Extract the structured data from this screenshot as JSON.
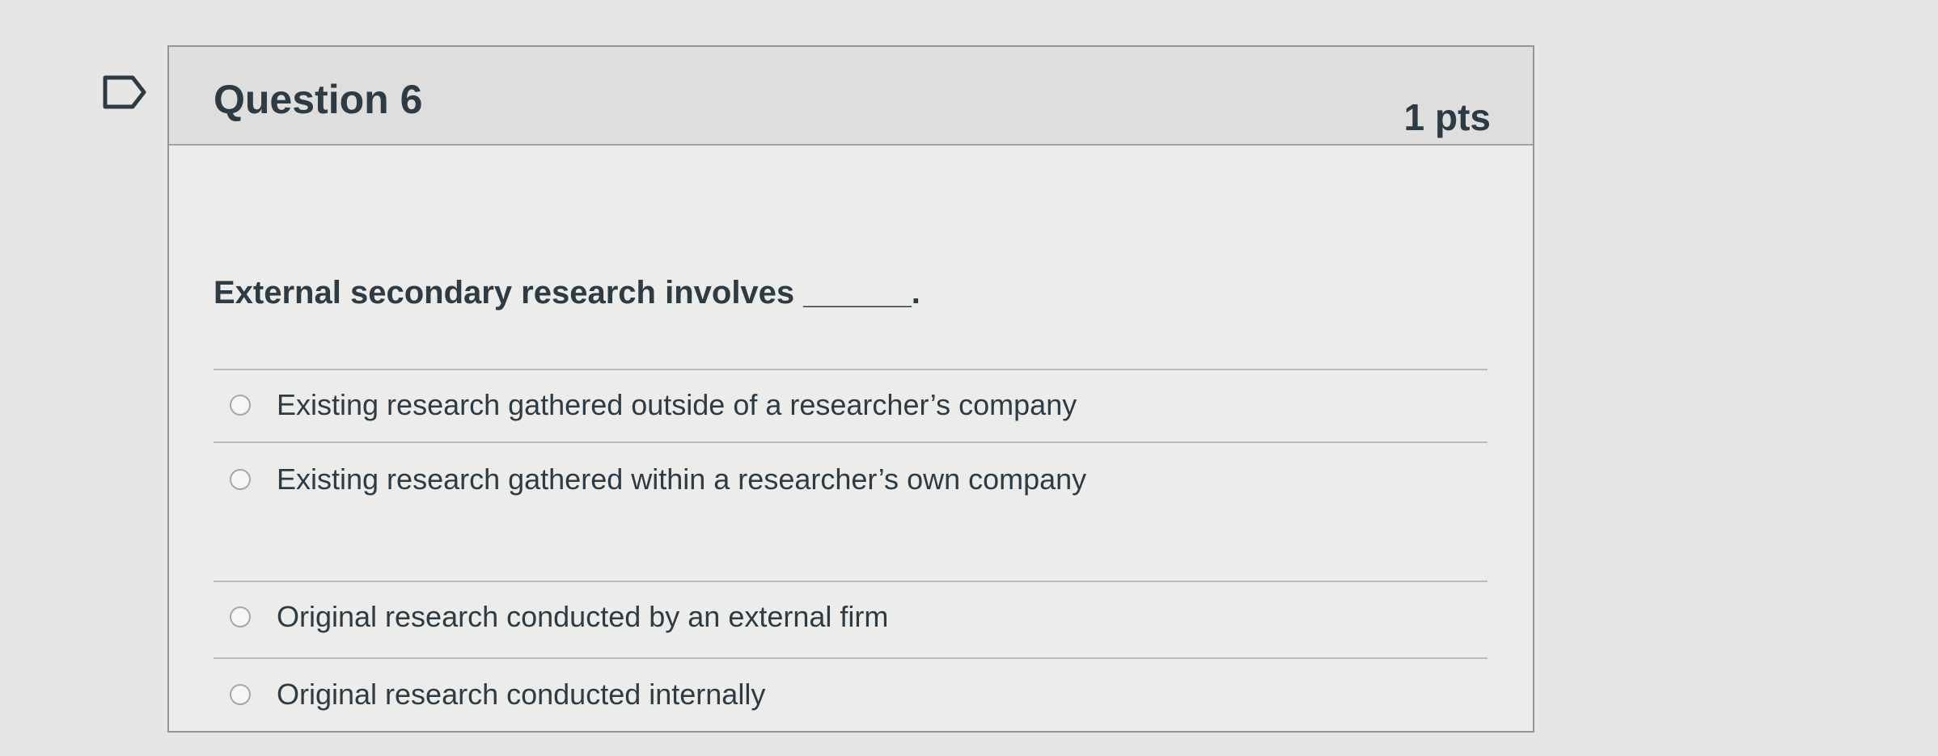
{
  "question": {
    "title": "Question 6",
    "points": "1 pts",
    "text": "External secondary research involves ______.",
    "flag_icon": "flag-icon",
    "answers": [
      {
        "label": "Existing research gathered outside of a researcher’s company",
        "radio_icon": "radio-icon",
        "selected": false
      },
      {
        "label": "Existing research gathered within a researcher’s own company",
        "radio_icon": "radio-icon",
        "selected": false
      },
      {
        "label": "Original research conducted by an external firm",
        "radio_icon": "radio-icon",
        "selected": false
      },
      {
        "label": "Original research conducted internally",
        "radio_icon": "radio-icon",
        "selected": false
      }
    ]
  }
}
